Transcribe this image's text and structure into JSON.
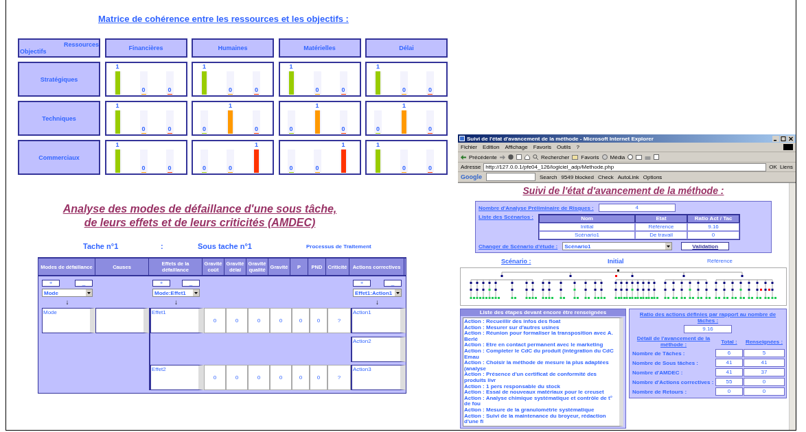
{
  "matrix": {
    "title": "Matrice de cohérence entre les ressources et les objectifs :",
    "corner_top": "Ressources",
    "corner_bottom": "Objectifs",
    "columns": [
      "Financières",
      "Humaines",
      "Matérielles",
      "Délai"
    ],
    "rows": [
      {
        "label": "Stratégiques",
        "cells": [
          {
            "bars": [
              {
                "level": 1,
                "reading": "1",
                "color": "#99cc00"
              },
              {
                "level": 0,
                "reading": "0",
                "color": "#ff9900"
              },
              {
                "level": 0,
                "reading": "0",
                "color": "#ff3300"
              }
            ]
          },
          {
            "bars": [
              {
                "level": 1,
                "reading": "1",
                "color": "#99cc00"
              },
              {
                "level": 0,
                "reading": "0",
                "color": "#ff9900"
              },
              {
                "level": 0,
                "reading": "0",
                "color": "#ff3300"
              }
            ]
          },
          {
            "bars": [
              {
                "level": 1,
                "reading": "1",
                "color": "#99cc00"
              },
              {
                "level": 0,
                "reading": "0",
                "color": "#ff9900"
              },
              {
                "level": 0,
                "reading": "0",
                "color": "#ff3300"
              }
            ]
          },
          {
            "bars": [
              {
                "level": 1,
                "reading": "1",
                "color": "#99cc00"
              },
              {
                "level": 0,
                "reading": "0",
                "color": "#ff9900"
              },
              {
                "level": 0,
                "reading": "0",
                "color": "#ff3300"
              }
            ]
          }
        ]
      },
      {
        "label": "Techniques",
        "cells": [
          {
            "bars": [
              {
                "level": 1,
                "reading": "1",
                "color": "#99cc00"
              },
              {
                "level": 0,
                "reading": "0",
                "color": "#ff9900"
              },
              {
                "level": 0,
                "reading": "0",
                "color": "#ff3300"
              }
            ]
          },
          {
            "bars": [
              {
                "level": 0,
                "reading": "0",
                "color": "#99cc00"
              },
              {
                "level": 1,
                "reading": "1",
                "color": "#ff9900"
              },
              {
                "level": 0,
                "reading": "0",
                "color": "#ff3300"
              }
            ]
          },
          {
            "bars": [
              {
                "level": 0,
                "reading": "0",
                "color": "#99cc00"
              },
              {
                "level": 1,
                "reading": "1",
                "color": "#ff9900"
              },
              {
                "level": 0,
                "reading": "0",
                "color": "#ff3300"
              }
            ]
          },
          {
            "bars": [
              {
                "level": 0,
                "reading": "0",
                "color": "#99cc00"
              },
              {
                "level": 1,
                "reading": "1",
                "color": "#ff9900"
              },
              {
                "level": 0,
                "reading": "0",
                "color": "#ff3300"
              }
            ]
          }
        ]
      },
      {
        "label": "Commerciaux",
        "cells": [
          {
            "bars": [
              {
                "level": 1,
                "reading": "1",
                "color": "#99cc00"
              },
              {
                "level": 0,
                "reading": "0",
                "color": "#ff9900"
              },
              {
                "level": 0,
                "reading": "0",
                "color": "#ff3300"
              }
            ]
          },
          {
            "bars": [
              {
                "level": 0,
                "reading": "0",
                "color": "#99cc00"
              },
              {
                "level": 0,
                "reading": "0",
                "color": "#ff9900"
              },
              {
                "level": 1,
                "reading": "1",
                "color": "#ff3300"
              }
            ]
          },
          {
            "bars": [
              {
                "level": 0,
                "reading": "0",
                "color": "#99cc00"
              },
              {
                "level": 0,
                "reading": "0",
                "color": "#ff9900"
              },
              {
                "level": 1,
                "reading": "1",
                "color": "#ff3300"
              }
            ]
          },
          {
            "bars": [
              {
                "level": 1,
                "reading": "1",
                "color": "#99cc00"
              },
              {
                "level": 0,
                "reading": "0",
                "color": "#ff9900"
              },
              {
                "level": 0,
                "reading": "0",
                "color": "#ff3300"
              }
            ]
          }
        ]
      }
    ]
  },
  "amdec": {
    "title_line1": "Analyse des modes de défaillance d'une sous tâche,",
    "title_line2": "de leurs effets et de leurs criticités (AMDEC)",
    "task": "Tache n°1",
    "separator": ":",
    "subtask": "Sous tache n°1",
    "process": "Processus de Traitement",
    "columns": [
      "Modes de défaillance",
      "Causes",
      "Effets de la défaillance",
      "Gravité coût",
      "Gravité délai",
      "Gravité qualité",
      "Gravité",
      "P",
      "PND",
      "Criticité",
      "Actions correctives"
    ],
    "mode_controls": {
      "add": "+",
      "remove": "_",
      "select": "Mode",
      "arrow": "↓"
    },
    "effect_controls": {
      "add": "+",
      "remove": "_",
      "select": "Mode:Effet1",
      "arrow": "↓"
    },
    "action_controls": {
      "add": "+",
      "remove": "_",
      "select": "Effet1:Action1",
      "arrow": "↓"
    },
    "mode": "Mode",
    "effects": [
      {
        "effect": "Effet1",
        "scores": [
          "0",
          "0",
          "0",
          "0",
          "0",
          "0",
          "?"
        ],
        "actions": [
          "Action1",
          "Action2"
        ]
      },
      {
        "effect": "Effet2",
        "scores": [
          "0",
          "0",
          "0",
          "0",
          "0",
          "0",
          "?"
        ],
        "actions": [
          "Action3"
        ]
      }
    ]
  },
  "browser": {
    "title": "Suivi de l'état d'avancement de la méthode - Microsoft Internet Explorer",
    "menu": [
      "Fichier",
      "Edition",
      "Affichage",
      "Favoris",
      "Outils",
      "?"
    ],
    "toolbar": {
      "back": "Précédente",
      "search": "Rechercher",
      "favorites": "Favoris",
      "media": "Média"
    },
    "address": {
      "label": "Adresse",
      "url": "http://127.0.0.1/pfe04_126/logiciel_adp/Methode.php",
      "go": "OK",
      "links": "Liens"
    },
    "google_bar": {
      "logo": "Google",
      "search": "Search",
      "blocked": "9549 blocked",
      "check": "Check",
      "autolink": "AutoLink",
      "options": "Options"
    },
    "page": {
      "title": "Suivi de l'état d'avancement de la méthode :",
      "apr_label": "Nombre d'Analyse Préliminaire de Risques :",
      "apr_value": "4",
      "scenarios_label": "Liste des Scénarios :",
      "scenario_columns": [
        "Nom",
        "Etat",
        "Ratio Act / Tac"
      ],
      "scenarios": [
        [
          "Initial",
          "Référence",
          "9.16"
        ],
        [
          "Scénario1",
          "De travail",
          "0"
        ]
      ],
      "change_label": "Changer de Scénario d'étude :",
      "change_value": "Scénario1",
      "validate": "Validation",
      "scenario_label": "Scénario :",
      "scenario_name": "Initial",
      "scenario_state": "Référence",
      "todo_title": "Liste des étapes devant encore être renseignées",
      "todo": [
        "Action : Recueillir des infos des float",
        "Action : Mesurer sur d'autres usines",
        "Action : Réunion pour formaliser la transposition avec A. Berlé",
        "Action : Etre en contact permanent avec le marketing",
        "Action : Completer le CdC du produit (intégration du CdC Emau",
        "Action : Choisir la méthode de mesure la plus adaptées (analyse",
        "Action : Présence d'un certificat de conformité des produits livr",
        "Action : 1 pers responsable du stock",
        "Action : Essai de nouveaux matériaux pour le creuset",
        "Action : Analyse chimique systématique et contrôle de t° de fou",
        "Action : Mesure de la granulométrie systématique",
        "Action : Suivi de la maintenance du broyeur, rédaction d'une fi"
      ],
      "ratio_label": "Ratio des actions définies par rapport au nombre de tâches :",
      "ratio_value": "9.16",
      "detail_label": "Détail de l'avancement de la méthode :",
      "total_label": "Total :",
      "filled_label": "Renseignées :",
      "stats": [
        [
          "Nombre de Tâches :",
          "6",
          "5"
        ],
        [
          "Nombre de Sous tâches :",
          "41",
          "41"
        ],
        [
          "Nombre d'AMDEC :",
          "41",
          "37"
        ],
        [
          "Nombre d'Actions correctives :",
          "55",
          "0"
        ],
        [
          "Nombre de Retours :",
          "0",
          "0"
        ]
      ]
    }
  }
}
